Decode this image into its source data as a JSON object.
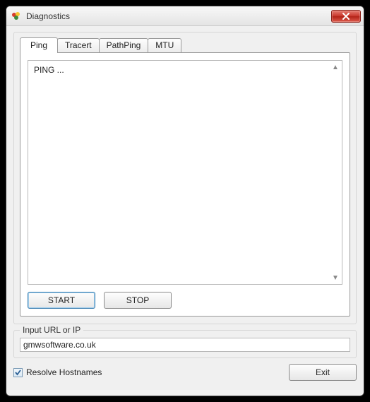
{
  "window": {
    "title": "Diagnostics"
  },
  "tabs": {
    "ping": "Ping",
    "tracert": "Tracert",
    "pathping": "PathPing",
    "mtu": "MTU"
  },
  "output": {
    "text": "PING ..."
  },
  "buttons": {
    "start": "START",
    "stop": "STOP",
    "exit": "Exit"
  },
  "input": {
    "label": "Input URL or IP",
    "value": "gmwsoftware.co.uk"
  },
  "resolve": {
    "label": "Resolve Hostnames",
    "checked": true
  }
}
